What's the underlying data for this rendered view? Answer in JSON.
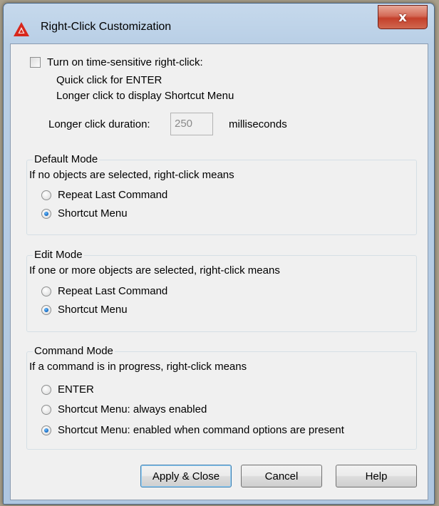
{
  "window": {
    "title": "Right-Click Customization",
    "close_symbol": "x"
  },
  "time_sensitive": {
    "label": "Turn on time-sensitive right-click:",
    "checked": false,
    "line1": "Quick click for ENTER",
    "line2": "Longer click to display Shortcut Menu",
    "duration_label": "Longer click duration:",
    "duration_value": "250",
    "duration_unit": "milliseconds"
  },
  "default_mode": {
    "title": "Default Mode",
    "description": "If no objects are selected, right-click means",
    "options": [
      "Repeat Last Command",
      "Shortcut Menu"
    ],
    "selected": 1
  },
  "edit_mode": {
    "title": "Edit Mode",
    "description": "If one or more objects are selected, right-click means",
    "options": [
      "Repeat Last Command",
      "Shortcut Menu"
    ],
    "selected": 1
  },
  "command_mode": {
    "title": "Command Mode",
    "description": "If a command is in progress, right-click means",
    "options": [
      "ENTER",
      "Shortcut Menu: always enabled",
      "Shortcut Menu: enabled when command options are present"
    ],
    "selected": 2
  },
  "buttons": {
    "apply": "Apply & Close",
    "cancel": "Cancel",
    "help": "Help"
  },
  "colors": {
    "close_button": "#c4402b",
    "radio_selected": "#1a6fc6",
    "app_icon": "#d8271c"
  }
}
